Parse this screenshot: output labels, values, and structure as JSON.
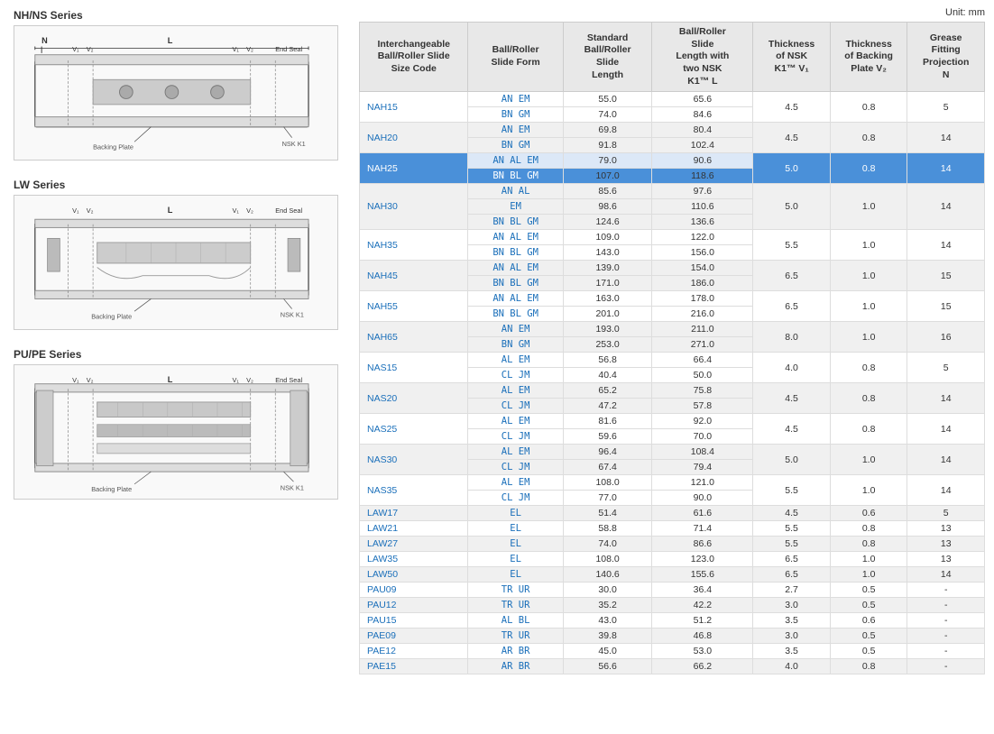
{
  "unit": "Unit: mm",
  "left_panel": {
    "series": [
      {
        "title": "NH/NS Series",
        "labels": [
          "N",
          "L",
          "V₁",
          "V₂",
          "End Seal",
          "Backing Plate",
          "NSK K1"
        ]
      },
      {
        "title": "LW Series",
        "labels": [
          "V₁",
          "V₂",
          "L",
          "V₁",
          "V₂",
          "End Seal",
          "Backing Plate",
          "NSK K1"
        ]
      },
      {
        "title": "PU/PE Series",
        "labels": [
          "V₁",
          "V₂",
          "L",
          "V₁",
          "V₂",
          "End Seal",
          "Backing Plate",
          "NSK K1"
        ]
      }
    ]
  },
  "table": {
    "headers": [
      "Interchangeable Ball/Roller Slide Size Code",
      "Ball/Roller Slide Form",
      "Standard Ball/Roller Slide Length",
      "Ball/Roller Slide Length with two NSK K1™ L",
      "Thickness of NSK K1™ V₁",
      "Thickness of Backing Plate V₂",
      "Grease Fitting Projection N"
    ],
    "rows": [
      {
        "size": "NAH15",
        "forms": [
          "AN",
          "BN"
        ],
        "subforms": [
          "EM",
          "GM"
        ],
        "lengths": [
          "55.0",
          "74.0"
        ],
        "lengths2": [
          "65.6",
          "84.6"
        ],
        "v1": "4.5",
        "v2": "0.8",
        "n": "5",
        "highlight": false
      },
      {
        "size": "NAH20",
        "forms": [
          "AN",
          "BN"
        ],
        "subforms": [
          "EM",
          "GM"
        ],
        "lengths": [
          "69.8",
          "91.8"
        ],
        "lengths2": [
          "80.4",
          "102.4"
        ],
        "v1": "4.5",
        "v2": "0.8",
        "n": "14",
        "highlight": false
      },
      {
        "size": "NAH25",
        "forms": [
          "AN",
          "BN"
        ],
        "subforms": [
          "AL EM",
          "BL GM"
        ],
        "lengths": [
          "79.0",
          "107.0"
        ],
        "lengths2": [
          "90.6",
          "118.6"
        ],
        "v1": "5.0",
        "v2": "0.8",
        "n": "14",
        "highlight": true
      },
      {
        "size": "NAH30",
        "forms": [
          "AN",
          "",
          "BN"
        ],
        "subforms": [
          "AL",
          "EM",
          "BL GM"
        ],
        "lengths": [
          "85.6",
          "98.6",
          "124.6"
        ],
        "lengths2": [
          "97.6",
          "110.6",
          "136.6"
        ],
        "v1": "5.0",
        "v2": "1.0",
        "n": "14",
        "highlight": false
      },
      {
        "size": "NAH35",
        "forms": [
          "AN",
          "BN"
        ],
        "subforms": [
          "AL EM",
          "BL GM"
        ],
        "lengths": [
          "109.0",
          "143.0"
        ],
        "lengths2": [
          "122.0",
          "156.0"
        ],
        "v1": "5.5",
        "v2": "1.0",
        "n": "14",
        "highlight": false
      },
      {
        "size": "NAH45",
        "forms": [
          "AN",
          "BN"
        ],
        "subforms": [
          "AL EM",
          "BL GM"
        ],
        "lengths": [
          "139.0",
          "171.0"
        ],
        "lengths2": [
          "154.0",
          "186.0"
        ],
        "v1": "6.5",
        "v2": "1.0",
        "n": "15",
        "highlight": false
      },
      {
        "size": "NAH55",
        "forms": [
          "AN",
          "BN"
        ],
        "subforms": [
          "AL EM",
          "BL GM"
        ],
        "lengths": [
          "163.0",
          "201.0"
        ],
        "lengths2": [
          "178.0",
          "216.0"
        ],
        "v1": "6.5",
        "v2": "1.0",
        "n": "15",
        "highlight": false
      },
      {
        "size": "NAH65",
        "forms": [
          "AN",
          "BN"
        ],
        "subforms": [
          "EM",
          "GM"
        ],
        "lengths": [
          "193.0",
          "253.0"
        ],
        "lengths2": [
          "211.0",
          "271.0"
        ],
        "v1": "8.0",
        "v2": "1.0",
        "n": "16",
        "highlight": false
      },
      {
        "size": "NAS15",
        "forms": [
          "AL",
          "CL"
        ],
        "subforms": [
          "EM",
          "JM"
        ],
        "lengths": [
          "56.8",
          "40.4"
        ],
        "lengths2": [
          "66.4",
          "50.0"
        ],
        "v1": "4.0",
        "v2": "0.8",
        "n": "5",
        "highlight": false
      },
      {
        "size": "NAS20",
        "forms": [
          "AL",
          "CL"
        ],
        "subforms": [
          "EM",
          "JM"
        ],
        "lengths": [
          "65.2",
          "47.2"
        ],
        "lengths2": [
          "75.8",
          "57.8"
        ],
        "v1": "4.5",
        "v2": "0.8",
        "n": "14",
        "highlight": false
      },
      {
        "size": "NAS25",
        "forms": [
          "AL",
          "CL"
        ],
        "subforms": [
          "EM",
          "JM"
        ],
        "lengths": [
          "81.6",
          "59.6"
        ],
        "lengths2": [
          "92.0",
          "70.0"
        ],
        "v1": "4.5",
        "v2": "0.8",
        "n": "14",
        "highlight": false
      },
      {
        "size": "NAS30",
        "forms": [
          "AL",
          "CL"
        ],
        "subforms": [
          "EM",
          "JM"
        ],
        "lengths": [
          "96.4",
          "67.4"
        ],
        "lengths2": [
          "108.4",
          "79.4"
        ],
        "v1": "5.0",
        "v2": "1.0",
        "n": "14",
        "highlight": false
      },
      {
        "size": "NAS35",
        "forms": [
          "AL",
          "CL"
        ],
        "subforms": [
          "EM",
          "JM"
        ],
        "lengths": [
          "108.0",
          "77.0"
        ],
        "lengths2": [
          "121.0",
          "90.0"
        ],
        "v1": "5.5",
        "v2": "1.0",
        "n": "14",
        "highlight": false
      },
      {
        "size": "LAW17",
        "forms": [
          "EL"
        ],
        "subforms": [
          ""
        ],
        "lengths": [
          "51.4"
        ],
        "lengths2": [
          "61.6"
        ],
        "v1": "4.5",
        "v2": "0.6",
        "n": "5",
        "highlight": false
      },
      {
        "size": "LAW21",
        "forms": [
          "EL"
        ],
        "subforms": [
          ""
        ],
        "lengths": [
          "58.8"
        ],
        "lengths2": [
          "71.4"
        ],
        "v1": "5.5",
        "v2": "0.8",
        "n": "13",
        "highlight": false
      },
      {
        "size": "LAW27",
        "forms": [
          "EL"
        ],
        "subforms": [
          ""
        ],
        "lengths": [
          "74.0"
        ],
        "lengths2": [
          "86.6"
        ],
        "v1": "5.5",
        "v2": "0.8",
        "n": "13",
        "highlight": false
      },
      {
        "size": "LAW35",
        "forms": [
          "EL"
        ],
        "subforms": [
          ""
        ],
        "lengths": [
          "108.0"
        ],
        "lengths2": [
          "123.0"
        ],
        "v1": "6.5",
        "v2": "1.0",
        "n": "13",
        "highlight": false
      },
      {
        "size": "LAW50",
        "forms": [
          "EL"
        ],
        "subforms": [
          ""
        ],
        "lengths": [
          "140.6"
        ],
        "lengths2": [
          "155.6"
        ],
        "v1": "6.5",
        "v2": "1.0",
        "n": "14",
        "highlight": false
      },
      {
        "size": "PAU09",
        "forms": [
          "TR"
        ],
        "subforms": [
          "UR"
        ],
        "lengths": [
          "30.0"
        ],
        "lengths2": [
          "36.4"
        ],
        "v1": "2.7",
        "v2": "0.5",
        "n": "-",
        "highlight": false
      },
      {
        "size": "PAU12",
        "forms": [
          "TR"
        ],
        "subforms": [
          "UR"
        ],
        "lengths": [
          "35.2"
        ],
        "lengths2": [
          "42.2"
        ],
        "v1": "3.0",
        "v2": "0.5",
        "n": "-",
        "highlight": false
      },
      {
        "size": "PAU15",
        "forms": [
          "AL"
        ],
        "subforms": [
          "BL"
        ],
        "lengths": [
          "43.0"
        ],
        "lengths2": [
          "51.2"
        ],
        "v1": "3.5",
        "v2": "0.6",
        "n": "-",
        "highlight": false
      },
      {
        "size": "PAE09",
        "forms": [
          "TR"
        ],
        "subforms": [
          "UR"
        ],
        "lengths": [
          "39.8"
        ],
        "lengths2": [
          "46.8"
        ],
        "v1": "3.0",
        "v2": "0.5",
        "n": "-",
        "highlight": false
      },
      {
        "size": "PAE12",
        "forms": [
          "AR"
        ],
        "subforms": [
          "BR"
        ],
        "lengths": [
          "45.0"
        ],
        "lengths2": [
          "53.0"
        ],
        "v1": "3.5",
        "v2": "0.5",
        "n": "-",
        "highlight": false
      },
      {
        "size": "PAE15",
        "forms": [
          "AR"
        ],
        "subforms": [
          "BR"
        ],
        "lengths": [
          "56.6"
        ],
        "lengths2": [
          "66.2"
        ],
        "v1": "4.0",
        "v2": "0.8",
        "n": "-",
        "highlight": false
      }
    ]
  }
}
